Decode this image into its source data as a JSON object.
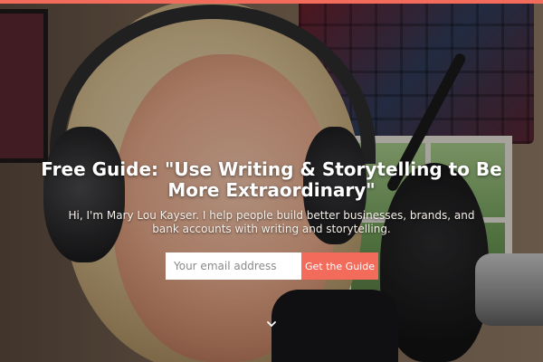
{
  "hero": {
    "headline": "Free Guide: \"Use Writing & Storytelling to Be More Extraordinary\"",
    "subtext": "Hi, I'm Mary Lou Kayser. I help people build better businesses, brands, and bank accounts with writing and storytelling."
  },
  "signup": {
    "email_placeholder": "Your email address",
    "submit_label": "Get the Guide"
  },
  "scroll": {
    "icon": "chevron-down-icon",
    "glyph": "⌄"
  },
  "colors": {
    "accent": "#f26b5b",
    "top_bar": "#f26b5b"
  }
}
